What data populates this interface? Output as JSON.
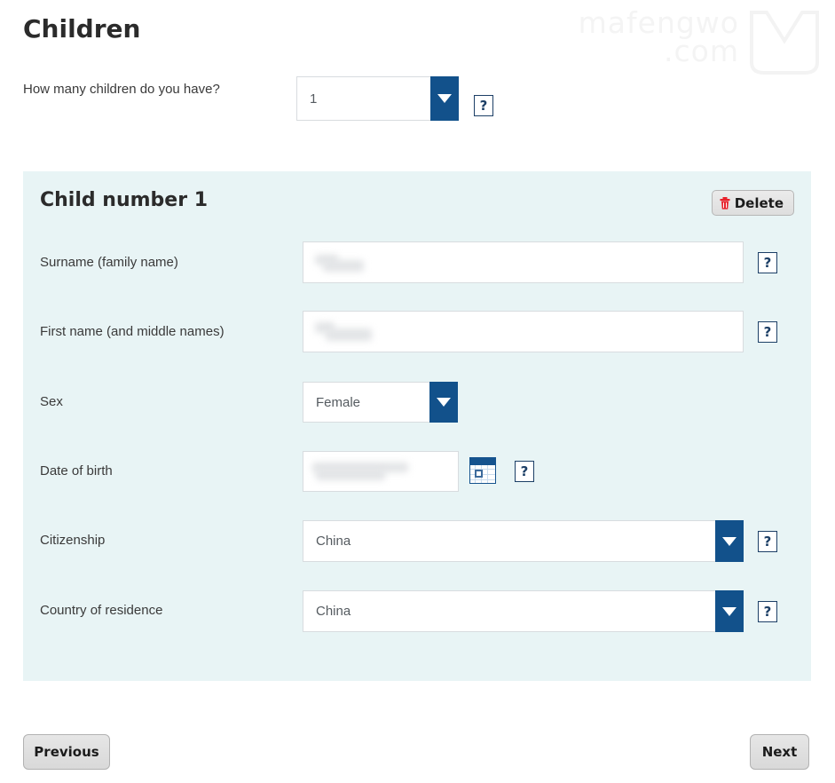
{
  "page": {
    "title": "Children"
  },
  "watermark": {
    "line1": "mafengwo",
    "line2": ".com",
    "logo": "mafengwo-m-logo"
  },
  "top_question": {
    "label": "How many children do you have?",
    "select_value": "1",
    "help_label": "?",
    "arrow_icon": "chevron-down-icon"
  },
  "child_panel": {
    "title": "Child number 1",
    "delete_label": "Delete",
    "delete_icon": "trash-icon",
    "fields": [
      {
        "label": "Surname (family name)",
        "type": "text",
        "value": "",
        "redacted": true,
        "help_label": "?"
      },
      {
        "label": "First name (and middle names)",
        "type": "text",
        "value": "",
        "redacted": true,
        "help_label": "?"
      },
      {
        "label": "Sex",
        "type": "select",
        "value": "Female",
        "arrow_icon": "chevron-down-icon",
        "help_label": ""
      },
      {
        "label": "Date of birth",
        "type": "date",
        "value": "",
        "redacted": true,
        "calendar_icon": "calendar-icon",
        "help_label": "?"
      },
      {
        "label": "Citizenship",
        "type": "select",
        "value": "China",
        "arrow_icon": "chevron-down-icon",
        "help_label": "?"
      },
      {
        "label": "Country of residence",
        "type": "select",
        "value": "China",
        "arrow_icon": "chevron-down-icon",
        "help_label": "?"
      }
    ]
  },
  "footer": {
    "previous_label": "Previous",
    "next_label": "Next"
  },
  "colors": {
    "panel_background": "#e8f4f5",
    "accent_blue": "#12518b",
    "help_border": "#1c3f66",
    "delete_icon": "#e8202a",
    "page_background": "#ffffff"
  }
}
